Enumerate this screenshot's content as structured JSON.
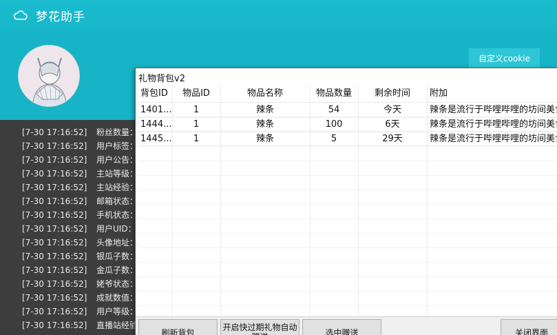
{
  "app": {
    "title": "梦花助手",
    "icon": "cloud-icon"
  },
  "header": {
    "cookie_button": "自定义cookie"
  },
  "log": {
    "lines": [
      {
        "time": "[7-30  17:16:52]",
        "text": "粉丝数量："
      },
      {
        "time": "[7-30  17:16:52]",
        "text": "用户标签："
      },
      {
        "time": "[7-30  17:16:52]",
        "text": "用户公告："
      },
      {
        "time": "[7-30  17:16:52]",
        "text": "主站等级："
      },
      {
        "time": "[7-30  17:16:52]",
        "text": "主站经验："
      },
      {
        "time": "[7-30  17:16:52]",
        "text": "邮箱状态："
      },
      {
        "time": "[7-30  17:16:52]",
        "text": "手机状态："
      },
      {
        "time": "[7-30  17:16:52]",
        "text": "用户UID："
      },
      {
        "time": "[7-30  17:16:52]",
        "text": "头像地址："
      },
      {
        "time": "[7-30  17:16:52]",
        "text": "银瓜子数："
      },
      {
        "time": "[7-30  17:16:52]",
        "text": "金瓜子数："
      },
      {
        "time": "[7-30  17:16:52]",
        "text": "姥爷状态："
      },
      {
        "time": "[7-30  17:16:52]",
        "text": "成就数值："
      },
      {
        "time": "[7-30  17:16:52]",
        "text": "用户等级："
      },
      {
        "time": "[7-30  17:16:52]",
        "text": "直播站经验"
      }
    ]
  },
  "dialog": {
    "title": "礼物背包v2",
    "columns": [
      "背包ID",
      "物品ID",
      "物品名称",
      "物品数量",
      "剩余时间",
      "附加"
    ],
    "rows": [
      [
        "1401...",
        "1",
        "辣条",
        "54",
        "今天",
        "辣条是流行于哔哩哔哩的坊间美食，"
      ],
      [
        "1444...",
        "1",
        "辣条",
        "100",
        "6天",
        "辣条是流行于哔哩哔哩的坊间美食，"
      ],
      [
        "1445...",
        "1",
        "辣条",
        "5",
        "29天",
        "辣条是流行于哔哩哔哩的坊间美食，"
      ]
    ],
    "buttons": {
      "refresh": "刷新背包",
      "auto_gift": "开启快过期礼物自动赠送",
      "send_selected": "选中赠送",
      "close": "关闭界面"
    }
  },
  "colors": {
    "accent": "#19b9cc",
    "log_bg": "#3d3d3d"
  }
}
